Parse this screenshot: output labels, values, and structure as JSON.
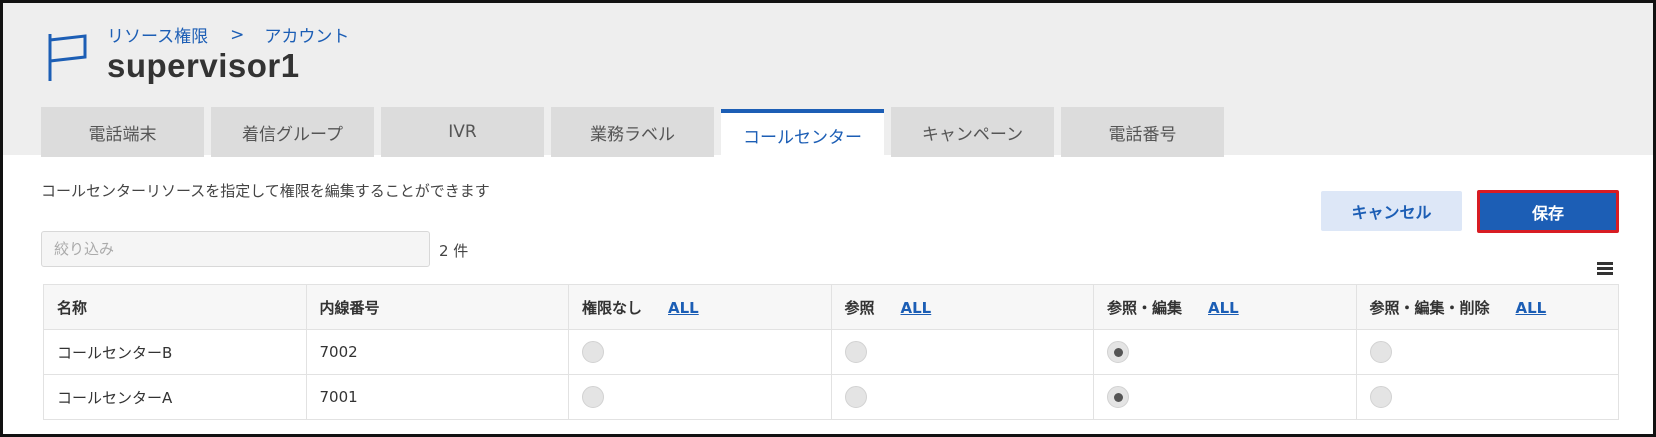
{
  "breadcrumb": {
    "items": [
      "リソース権限",
      "アカウント"
    ],
    "separator": ">"
  },
  "page_title": "supervisor1",
  "tabs": [
    {
      "label": "電話端末",
      "active": false
    },
    {
      "label": "着信グループ",
      "active": false
    },
    {
      "label": "IVR",
      "active": false
    },
    {
      "label": "業務ラベル",
      "active": false
    },
    {
      "label": "コールセンター",
      "active": true
    },
    {
      "label": "キャンペーン",
      "active": false
    },
    {
      "label": "電話番号",
      "active": false
    }
  ],
  "description": "コールセンターリソースを指定して権限を編集することができます",
  "filter": {
    "placeholder": "絞り込み",
    "value": ""
  },
  "count_label": "2 件",
  "buttons": {
    "cancel": "キャンセル",
    "save": "保存"
  },
  "table": {
    "columns": [
      {
        "label": "名称",
        "all": ""
      },
      {
        "label": "内線番号",
        "all": ""
      },
      {
        "label": "権限なし",
        "all": "ALL"
      },
      {
        "label": "参照",
        "all": "ALL"
      },
      {
        "label": "参照・編集",
        "all": "ALL"
      },
      {
        "label": "参照・編集・削除",
        "all": "ALL"
      }
    ],
    "rows": [
      {
        "name": "コールセンターB",
        "extension": "7002",
        "permission": "参照・編集"
      },
      {
        "name": "コールセンターA",
        "extension": "7001",
        "permission": "参照・編集"
      }
    ]
  },
  "colors": {
    "accent": "#1c5eb5",
    "save_highlight": "#d81c23",
    "header_bg": "#eeeeee"
  },
  "icons": {
    "header": "flag-icon",
    "menu": "hamburger-menu-icon"
  }
}
